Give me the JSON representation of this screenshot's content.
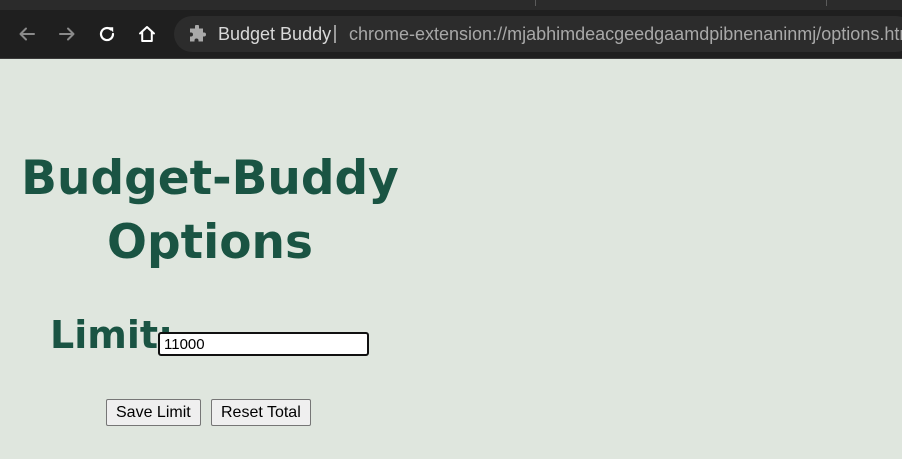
{
  "browser": {
    "site_name": "Budget Buddy",
    "url": "chrome-extension://mjabhimdeacgeedgaamdpibnenaninmj/options.html"
  },
  "page": {
    "title_line1": "Budget-Buddy",
    "title_line2": "Options",
    "limit_label": "Limit:",
    "limit_value": "11000",
    "save_button": "Save Limit",
    "reset_button": "Reset Total"
  },
  "colors": {
    "background": "#dfe6de",
    "heading": "#1a5443"
  },
  "icons": [
    "back-arrow-icon",
    "forward-arrow-icon",
    "reload-icon",
    "home-icon",
    "extension-puzzle-icon"
  ]
}
